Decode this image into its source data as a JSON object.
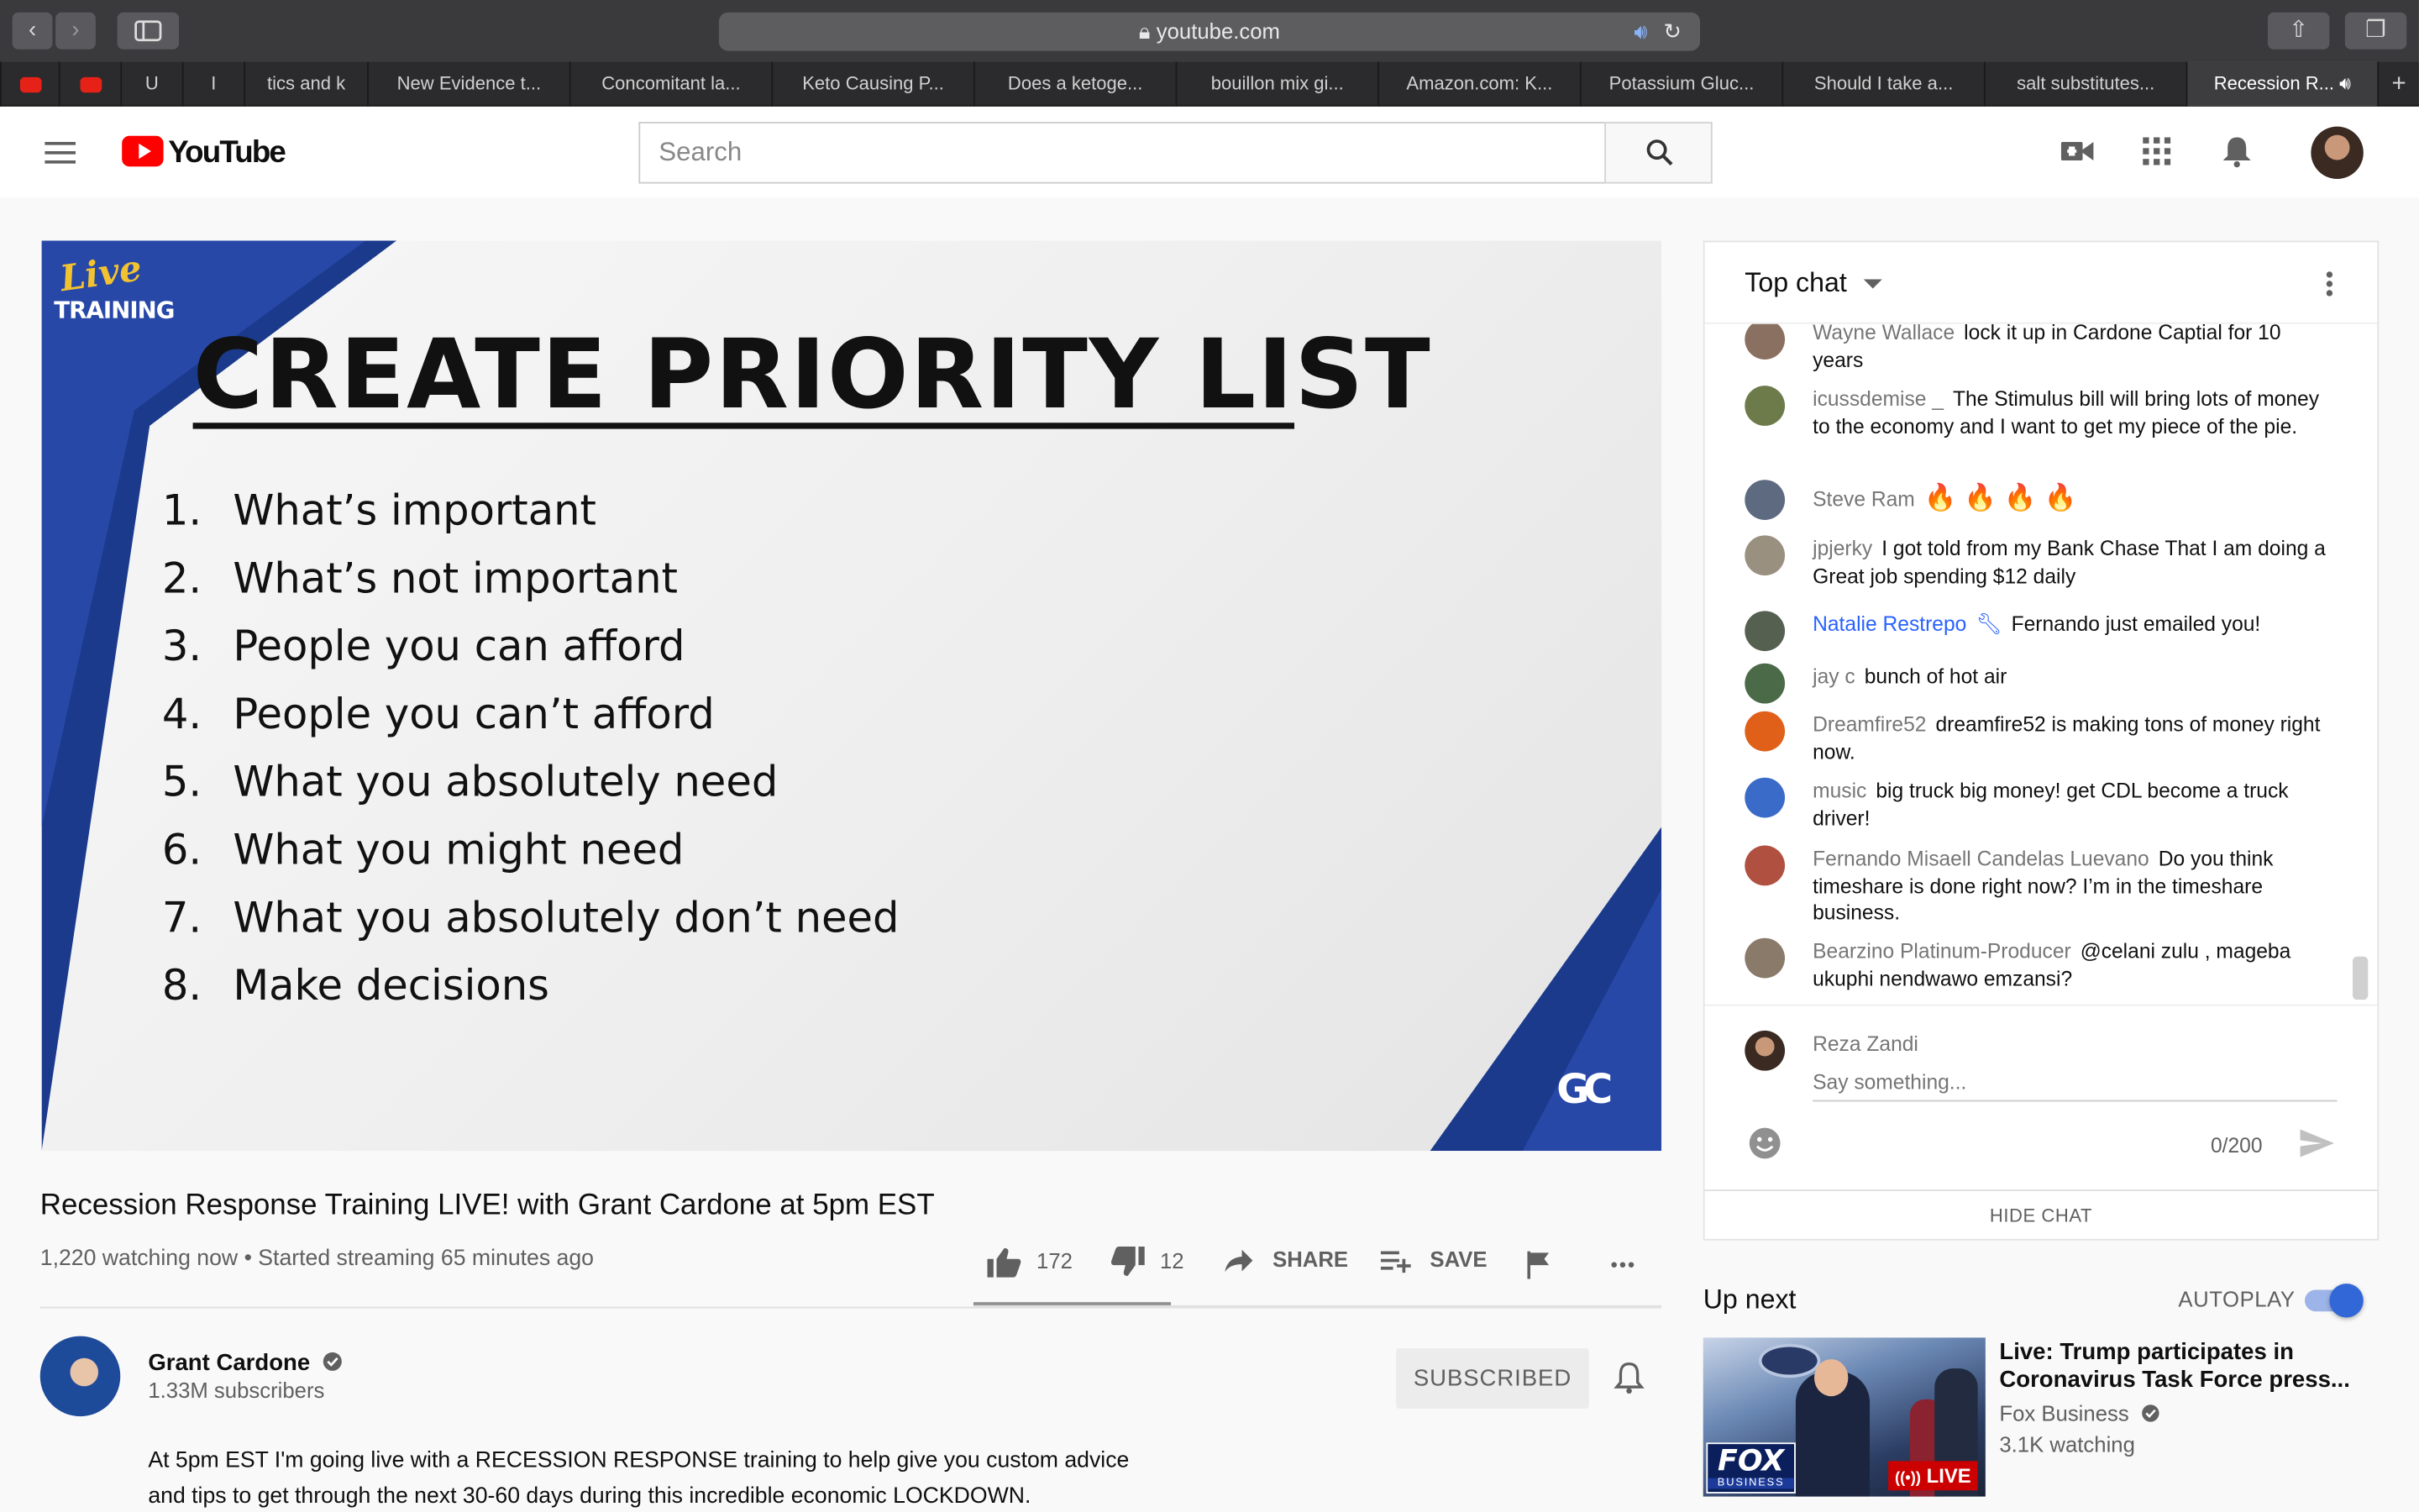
{
  "browser": {
    "url": "youtube.com",
    "tabs": [
      "",
      "",
      "U",
      "I",
      "tics and k",
      "New Evidence t...",
      "Concomitant la...",
      "Keto Causing P...",
      "Does a ketoge...",
      "bouillon mix gi...",
      "Amazon.com: K...",
      "Potassium Gluc...",
      "Should I take a...",
      "salt substitutes...",
      "Recession R..."
    ],
    "new_tab_glyph": "+"
  },
  "header": {
    "logo_text": "YouTube",
    "search_placeholder": "Search"
  },
  "video_slide": {
    "badge_line1": "Live",
    "badge_line2": "TRAINING",
    "title": "CREATE PRIORITY LIST",
    "items": [
      {
        "num": "1.",
        "text": "What’s important"
      },
      {
        "num": "2.",
        "text": "What’s not important"
      },
      {
        "num": "3.",
        "text": "People you can afford"
      },
      {
        "num": "4.",
        "text": "People you can’t afford"
      },
      {
        "num": "5.",
        "text": "What you absolutely need"
      },
      {
        "num": "6.",
        "text": "What you might need"
      },
      {
        "num": "7.",
        "text": "What you absolutely don’t need"
      },
      {
        "num": "8.",
        "text": "Make decisions"
      }
    ],
    "corner_logo": "GC"
  },
  "video_info": {
    "title": "Recession Response Training LIVE! with Grant Cardone at 5pm EST",
    "watching": "1,220 watching now • Started streaming 65 minutes ago",
    "likes": "172",
    "dislikes": "12",
    "share_label": "SHARE",
    "save_label": "SAVE",
    "more": "•••"
  },
  "channel": {
    "name": "Grant Cardone",
    "subscribers": "1.33M subscribers",
    "subscribe_label": "SUBSCRIBED",
    "description_line1": "At 5pm EST I'm going live with a RECESSION RESPONSE training to help give you custom advice",
    "description_line2": "and tips to get through the next 30-60 days during this incredible economic LOCKDOWN."
  },
  "chat": {
    "mode_label": "Top chat",
    "messages": [
      {
        "author": "Wayne Wallace",
        "text": "lock it up in Cardone Captial for 10 years",
        "color": "#8a7060"
      },
      {
        "author": "icussdemise _",
        "text": "The Stimulus bill will bring lots of money to the economy and I want to get my piece of the pie.",
        "color": "#6d7a4a"
      },
      {
        "author": "Steve Ram",
        "text": "🔥 🔥 🔥 🔥",
        "color": "#5d6a80"
      },
      {
        "author": "jpjerky",
        "text": "I got told from my Bank Chase That I am doing a Great job spending $12 daily",
        "color": "#9a9080"
      },
      {
        "author": "Natalie Restrepo",
        "text": "Fernando just emailed you!",
        "color": "#556050"
      },
      {
        "author": "jay c",
        "text": "bunch of hot air",
        "color": "#4a6a48"
      },
      {
        "author": "Dreamfire52",
        "text": "dreamfire52 is making tons of money right now.",
        "color": "#e0601a"
      },
      {
        "author": "music",
        "text": "big truck big money! get CDL become a truck driver!",
        "color": "#3a6bc8"
      },
      {
        "author": "Fernando Misaell Candelas Luevano",
        "text": "Do you think timeshare is done right now? I’m in the timeshare business.",
        "color": "#b05040"
      },
      {
        "author": "Bearzino Platinum-Producer",
        "text": "@celani zulu , mageba ukuphi nendwawo emzansi?",
        "color": "#8a7a6a"
      }
    ],
    "current_user": "Reza Zandi",
    "input_placeholder": "Say something...",
    "char_count": "0/200",
    "hide_label": "HIDE CHAT"
  },
  "up_next": {
    "heading": "Up next",
    "autoplay_label": "AUTOPLAY",
    "autoplay_on": true,
    "video_title": "Live: Trump participates in Coronavirus Task Force press...",
    "channel": "Fox Business",
    "watching": "3.1K watching",
    "live_badge": "LIVE",
    "thumb_logo_line1": "FOX",
    "thumb_logo_line2": "BUSINESS"
  },
  "colors": {
    "youtube_red": "#ff0000",
    "moderator_blue": "#2962ff",
    "slide_blue": "#1b3a8c",
    "autoplay_blue": "#3167d6"
  }
}
